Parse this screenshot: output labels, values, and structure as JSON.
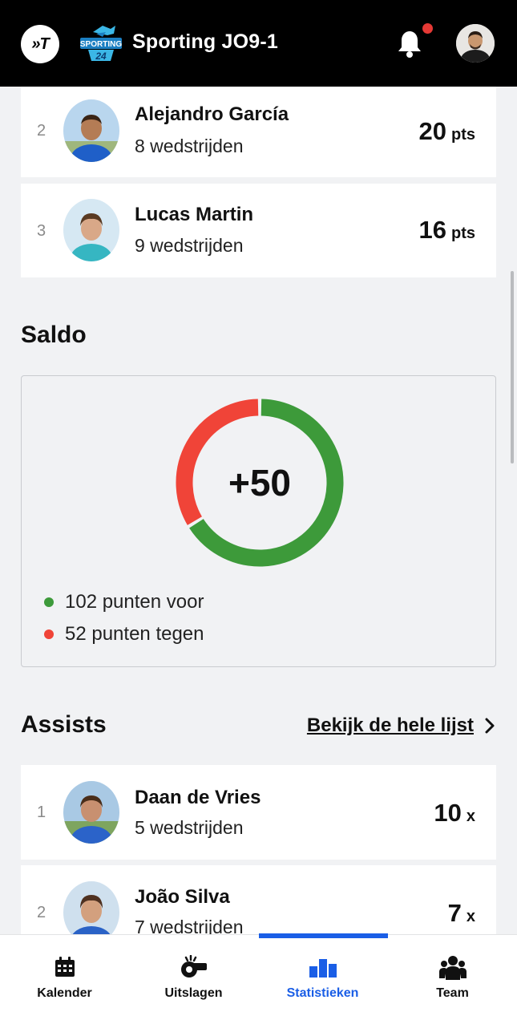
{
  "header": {
    "app_logo_text": "»T",
    "club_logo_name": "Sporting 24 logo",
    "club_logo_text_top": "SPORTING",
    "club_logo_text_bottom": "24",
    "team_name": "Sporting JO9-1",
    "has_notification": true,
    "accent_color": "#e53935"
  },
  "top_scorers": [
    {
      "rank": "2",
      "name": "Alejandro García",
      "matches": "8 wedstrijden",
      "value": "20",
      "unit": "pts"
    },
    {
      "rank": "3",
      "name": "Lucas Martin",
      "matches": "9 wedstrijden",
      "value": "16",
      "unit": "pts"
    }
  ],
  "saldo": {
    "title": "Saldo",
    "value": "+50",
    "points_for": 102,
    "points_against": 52,
    "legend_for": "102 punten voor",
    "legend_against": "52 punten tegen",
    "color_for": "#3d9a3a",
    "color_against": "#f04438"
  },
  "assists": {
    "title": "Assists",
    "see_all": "Bekijk de hele lijst",
    "players": [
      {
        "rank": "1",
        "name": "Daan de Vries",
        "matches": "5 wedstrijden",
        "value": "10",
        "unit": "x"
      },
      {
        "rank": "2",
        "name": "João Silva",
        "matches": "7 wedstrijden",
        "value": "7",
        "unit": "x"
      }
    ]
  },
  "bottom_nav": {
    "active": "Statistieken",
    "active_color": "#1a5ee6",
    "items": [
      {
        "label": "Kalender",
        "icon": "calendar-icon"
      },
      {
        "label": "Uitslagen",
        "icon": "whistle-icon"
      },
      {
        "label": "Statistieken",
        "icon": "bar-chart-icon"
      },
      {
        "label": "Team",
        "icon": "team-icon"
      }
    ]
  }
}
